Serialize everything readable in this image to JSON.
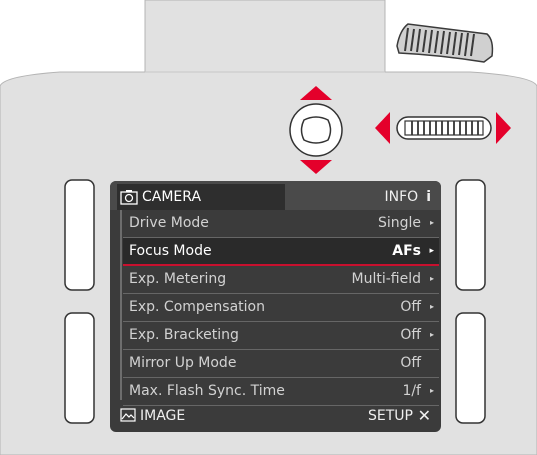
{
  "header": {
    "camera_tab": "CAMERA",
    "info_tab": "INFO",
    "info_icon": "i"
  },
  "menu": {
    "rows": [
      {
        "label": "Drive Mode",
        "value": "Single",
        "arrow": "▸"
      },
      {
        "label": "Focus Mode",
        "value": "AFs",
        "arrow": "▸"
      },
      {
        "label": "Exp. Metering",
        "value": "Multi-field",
        "arrow": "▸"
      },
      {
        "label": "Exp. Compensation",
        "value": "Off",
        "arrow": "▸"
      },
      {
        "label": "Exp. Bracketing",
        "value": "Off",
        "arrow": "▸"
      },
      {
        "label": "Mirror Up Mode",
        "value": "Off",
        "arrow": ""
      },
      {
        "label": "Max. Flash Sync. Time",
        "value": "1/f",
        "arrow": "▸"
      }
    ],
    "selected_index": 1
  },
  "footer": {
    "image_tab": "IMAGE",
    "setup_tab": "SETUP",
    "setup_icon": "✕"
  },
  "colors": {
    "accent_red": "#e4002b",
    "selection_line": "#c8102e",
    "body": "#e1e1e1"
  }
}
